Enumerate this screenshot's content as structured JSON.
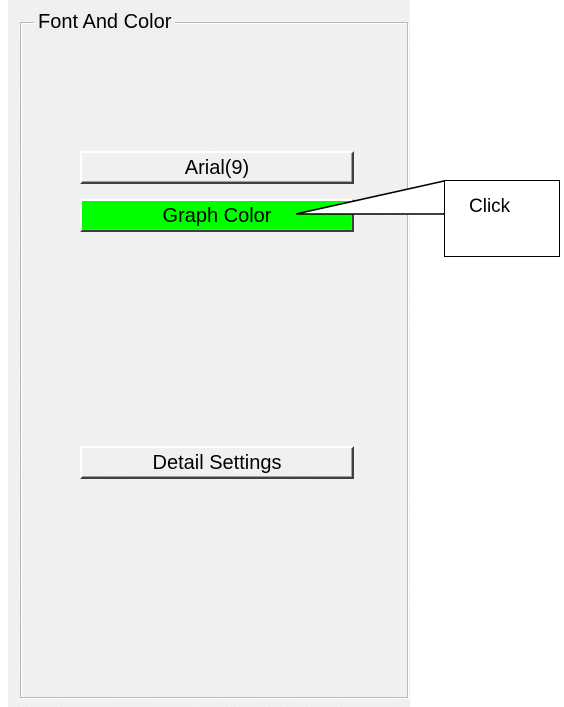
{
  "groupbox": {
    "title": "Font And Color"
  },
  "buttons": {
    "font": "Arial(9)",
    "graph_color": "Graph Color",
    "detail": "Detail Settings"
  },
  "colors": {
    "graph_color_swatch": "#00ff00"
  },
  "callout": {
    "text": "Click"
  }
}
